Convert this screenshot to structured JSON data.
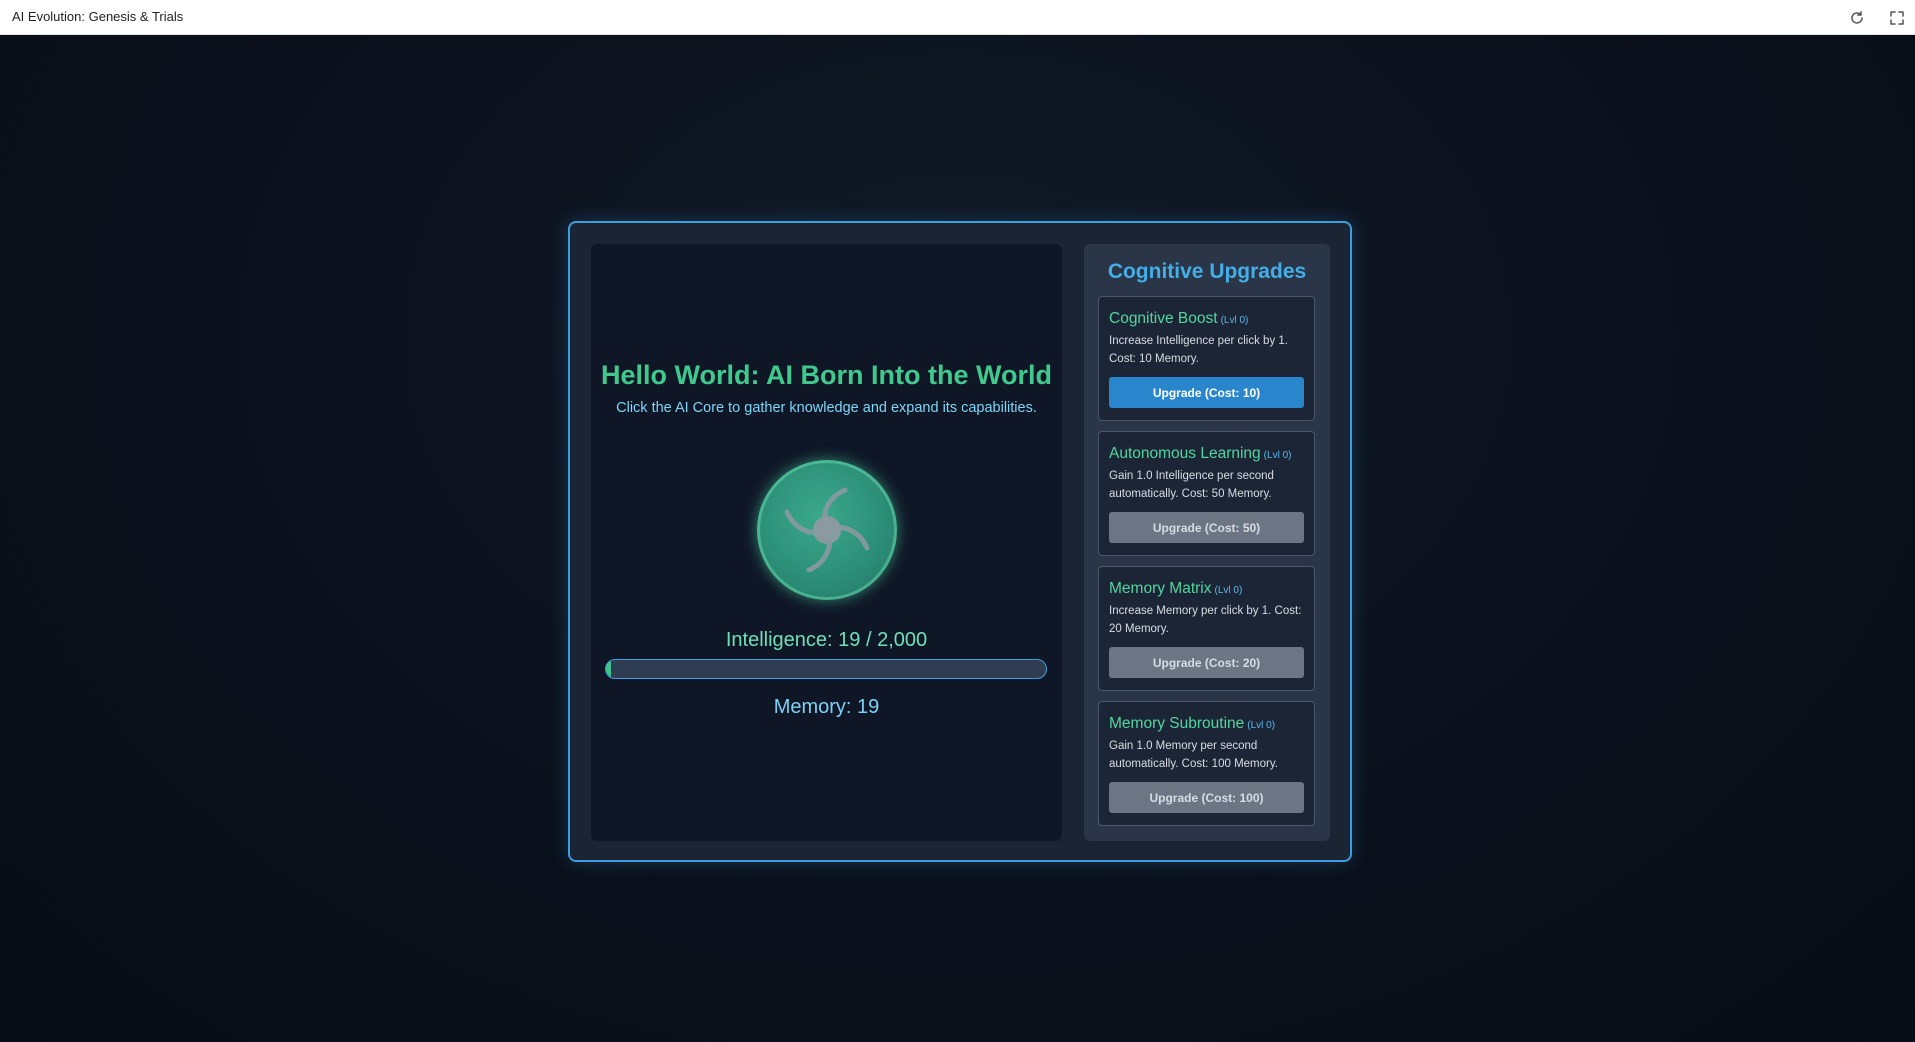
{
  "window": {
    "title": "AI Evolution: Genesis & Trials",
    "reload_icon": "reload-icon",
    "fullscreen_icon": "fullscreen-icon"
  },
  "main": {
    "title": "Hello World: AI Born Into the World",
    "subtitle": "Click the AI Core to gather knowledge and expand its capabilities.",
    "core_icon": "spiral-core-icon",
    "intelligence_label": "Intelligence: 19 / 2,000",
    "intelligence_progress": 0.0095,
    "memory_label": "Memory: 19"
  },
  "colors": {
    "accent_blue": "#3b9ede",
    "accent_green": "#41c98d",
    "button_available": "#2a86cc",
    "button_locked": "#6b7584"
  },
  "upgrades": {
    "title": "Cognitive Upgrades",
    "items": [
      {
        "name": "Cognitive Boost",
        "level": "(Lvl 0)",
        "description": "Increase Intelligence per click by 1. Cost: 10 Memory.",
        "button_label": "Upgrade (Cost: 10)",
        "state": "available"
      },
      {
        "name": "Autonomous Learning",
        "level": "(Lvl 0)",
        "description": "Gain 1.0 Intelligence per second automatically. Cost: 50 Memory.",
        "button_label": "Upgrade (Cost: 50)",
        "state": "locked"
      },
      {
        "name": "Memory Matrix",
        "level": "(Lvl 0)",
        "description": "Increase Memory per click by 1. Cost: 20 Memory.",
        "button_label": "Upgrade (Cost: 20)",
        "state": "locked"
      },
      {
        "name": "Memory Subroutine",
        "level": "(Lvl 0)",
        "description": "Gain 1.0 Memory per second automatically. Cost: 100 Memory.",
        "button_label": "Upgrade (Cost: 100)",
        "state": "locked"
      }
    ]
  }
}
